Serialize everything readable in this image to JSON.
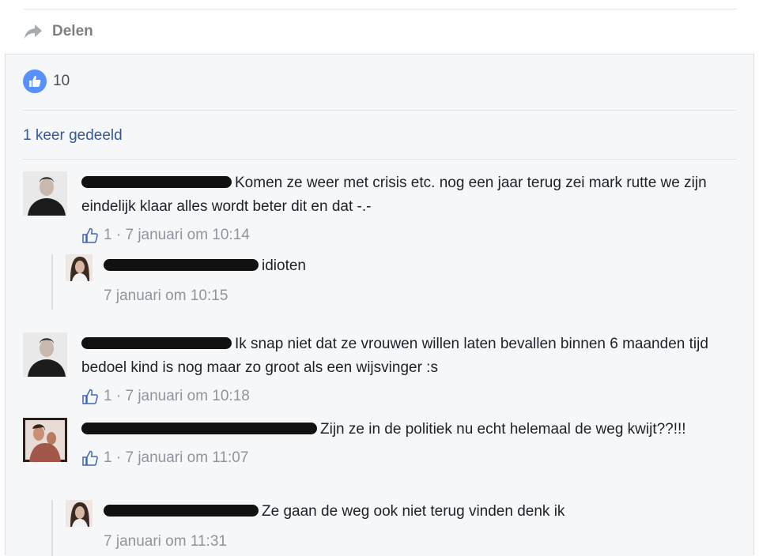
{
  "post": {
    "share_label": "Delen"
  },
  "ufi": {
    "like_count": "10",
    "shares_text": "1 keer gedeeld",
    "colors": {
      "link": "#365899",
      "like": "#5890ff",
      "meta": "#90949c"
    }
  },
  "comments": [
    {
      "text": "Komen ze weer met crisis etc. nog een jaar terug zei mark rutte we zijn eindelijk klaar alles wordt beter dit en dat -.-",
      "likes": "1",
      "separator": "·",
      "time": "7 januari om 10:14",
      "replies": [
        {
          "text": "idioten",
          "time": "7 januari om 10:15"
        }
      ]
    },
    {
      "text": "Ik snap niet dat ze vrouwen willen laten bevallen binnen 6 maanden tijd bedoel kind is nog maar zo groot als een wijsvinger :s",
      "likes": "1",
      "separator": "·",
      "time": "7 januari om 10:18"
    },
    {
      "text": "Zijn ze in de politiek nu echt helemaal de weg kwijt??!!!",
      "likes": "1",
      "separator": "·",
      "time": "7 januari om 11:07",
      "replies": [
        {
          "text": "Ze gaan de weg ook niet terug vinden denk ik",
          "time": "7 januari om 11:31"
        }
      ]
    }
  ]
}
